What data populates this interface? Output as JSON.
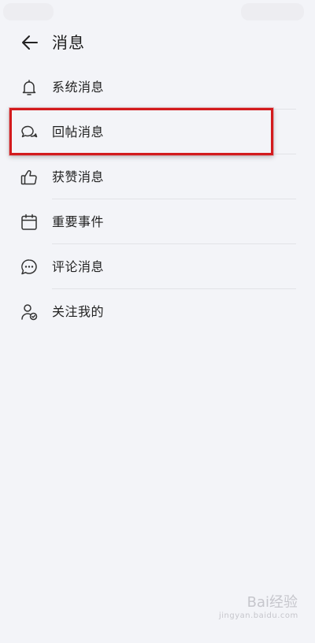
{
  "header": {
    "title": "消息"
  },
  "menu": {
    "items": [
      {
        "label": "系统消息",
        "icon": "bell-icon"
      },
      {
        "label": "回帖消息",
        "icon": "chat-bubbles-icon"
      },
      {
        "label": "获赞消息",
        "icon": "thumbs-up-icon"
      },
      {
        "label": "重要事件",
        "icon": "calendar-icon"
      },
      {
        "label": "评论消息",
        "icon": "comment-dots-icon"
      },
      {
        "label": "关注我的",
        "icon": "user-check-icon"
      }
    ]
  },
  "highlight": {
    "target": "回帖消息",
    "color": "#d31a1d"
  },
  "watermark": {
    "text": "Bai经验",
    "sub": "jingyan.baidu.com"
  },
  "colors": {
    "background": "#f3f4f8",
    "text": "#222222",
    "icon": "#333333",
    "divider": "#e2e3e7"
  }
}
